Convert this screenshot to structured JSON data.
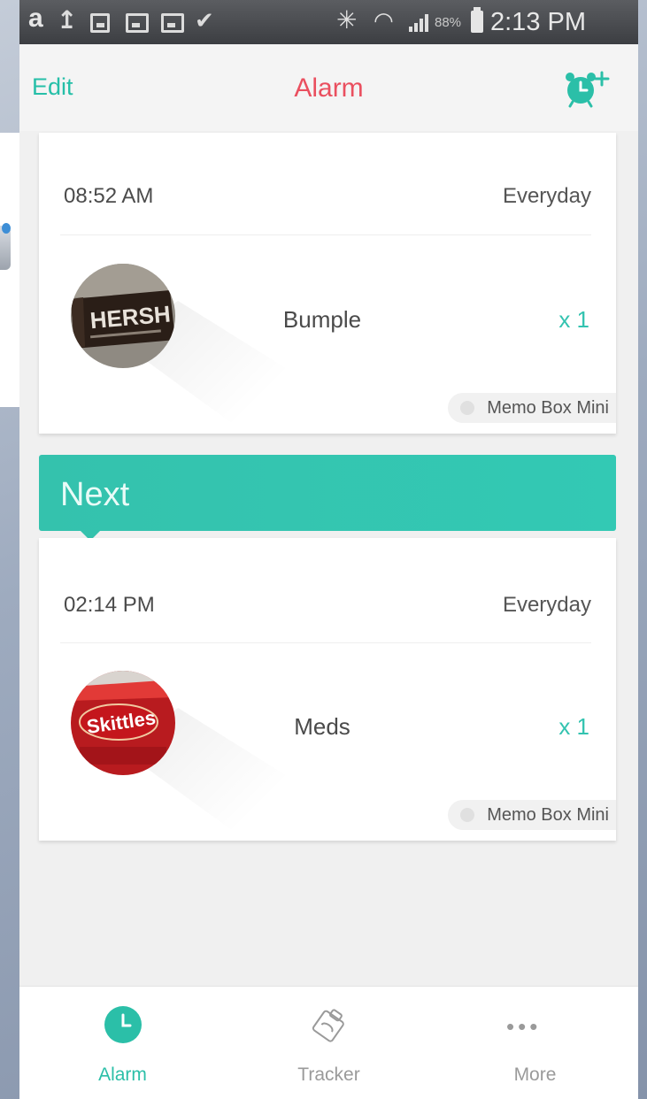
{
  "status_bar": {
    "battery_percent": "88%",
    "time": "2:13 PM"
  },
  "header": {
    "edit_label": "Edit",
    "title": "Alarm"
  },
  "alarms": [
    {
      "time": "08:52 AM",
      "repeat": "Everyday",
      "photo_text": "HERSH",
      "pill_name": "Bumple",
      "quantity": "x 1",
      "device": "Memo Box Mini"
    },
    {
      "time": "02:14 PM",
      "repeat": "Everyday",
      "photo_text": "Skittles",
      "pill_name": "Meds",
      "quantity": "x 1",
      "device": "Memo Box Mini"
    }
  ],
  "next_banner": {
    "label": "Next"
  },
  "bottom_nav": [
    {
      "label": "Alarm",
      "icon": "clock-icon",
      "active": true
    },
    {
      "label": "Tracker",
      "icon": "tracker-icon",
      "active": false
    },
    {
      "label": "More",
      "icon": "more-dots-icon",
      "active": false
    }
  ],
  "colors": {
    "accent": "#33c3b0",
    "title": "#ea4f5f",
    "background": "#f0f0f0"
  }
}
